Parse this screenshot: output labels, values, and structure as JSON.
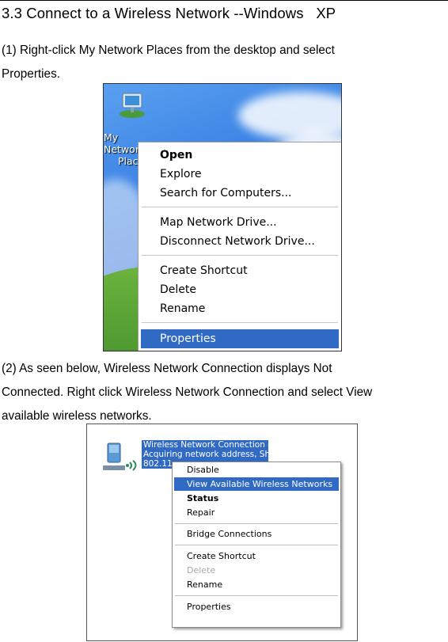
{
  "section": {
    "heading": "3.3 Connect to a Wireless Network --Windows   XP"
  },
  "step1": {
    "text_line1": "(1) Right-click My Network Places from the desktop and select",
    "text_line2": "Properties."
  },
  "screenshot1": {
    "desktop_icon_label_line1": "My Network",
    "desktop_icon_label_line2": "Places",
    "menu": {
      "open": "Open",
      "explore": "Explore",
      "search": "Search for Computers...",
      "map_drive": "Map Network Drive...",
      "disconnect_drive": "Disconnect Network Drive...",
      "create_shortcut": "Create Shortcut",
      "delete": "Delete",
      "rename": "Rename",
      "properties": "Properties"
    }
  },
  "step2": {
    "text_line1": "(2) As seen below, Wireless Network Connection displays Not",
    "text_line2": "Connected. Right click Wireless Network Connection and select View",
    "text_line3": "available wireless networks."
  },
  "screenshot2": {
    "connection_name": "Wireless Network Connection 4",
    "connection_status": "Acquiring network address, Sh...",
    "connection_type": "802.11",
    "menu": {
      "disable": "Disable",
      "view_networks": "View Available Wireless Networks",
      "status": "Status",
      "repair": "Repair",
      "bridge": "Bridge Connections",
      "create_shortcut": "Create Shortcut",
      "delete": "Delete",
      "rename": "Rename",
      "properties": "Properties"
    }
  }
}
